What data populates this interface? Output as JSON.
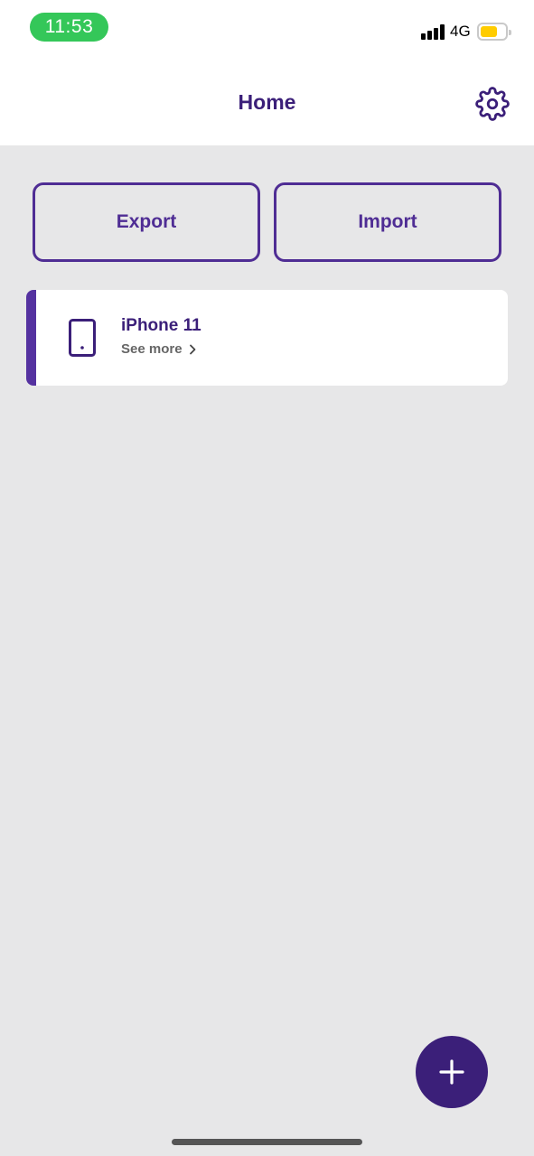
{
  "status_bar": {
    "time": "11:53",
    "network": "4G",
    "signal_icon": "signal-bars-icon",
    "battery_icon": "battery-icon",
    "battery_level": 0.7,
    "time_pill_color": "#34c759",
    "battery_color": "#ffcc00"
  },
  "header": {
    "title": "Home",
    "settings_icon": "gear-icon"
  },
  "actions": {
    "export_label": "Export",
    "import_label": "Import"
  },
  "devices": [
    {
      "name": "iPhone 11",
      "link_label": "See more",
      "icon": "phone-icon",
      "chevron_icon": "chevron-right-icon"
    }
  ],
  "fab": {
    "icon": "plus-icon"
  },
  "colors": {
    "accent": "#3b1f79",
    "accent_light": "#4f2d94",
    "background": "#e7e7e8",
    "card": "#ffffff",
    "secondary_text": "#666666"
  }
}
